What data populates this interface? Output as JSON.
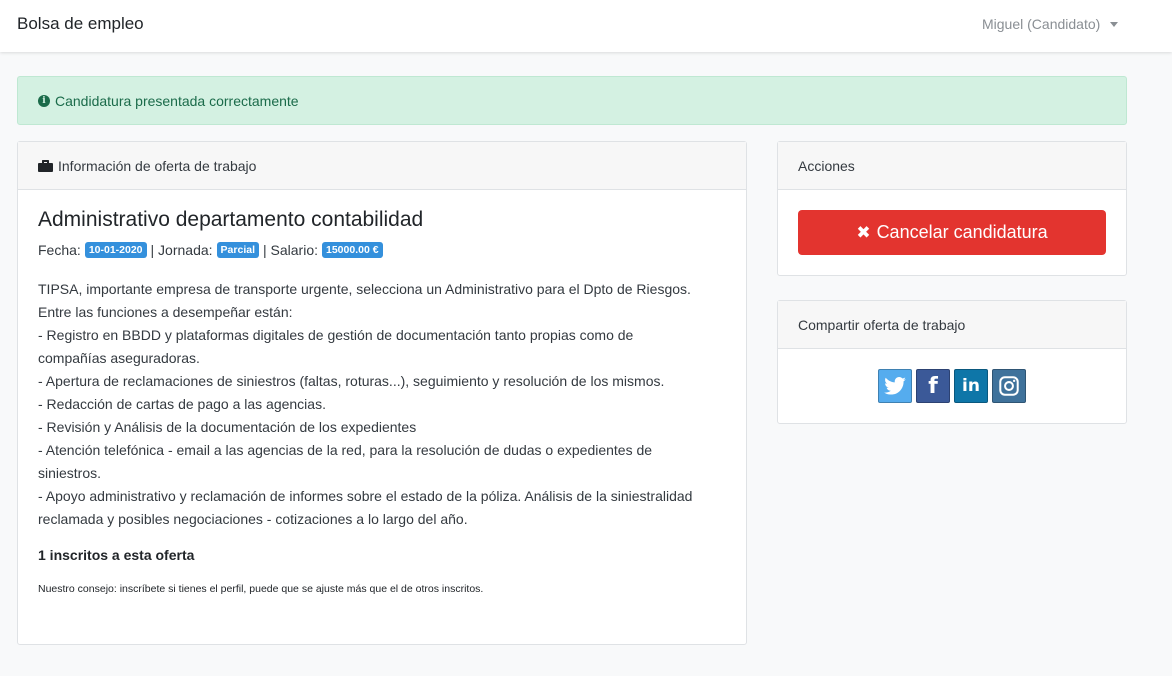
{
  "navbar": {
    "brand": "Bolsa de empleo",
    "user": "Miguel (Candidato)"
  },
  "alert": {
    "icon": "info-circle-icon",
    "message": "Candidatura presentada correctamente",
    "color": "#d4f1e2"
  },
  "job_card": {
    "header_icon": "briefcase-icon",
    "header": "Información de oferta de trabajo",
    "title": "Administrativo departamento contabilidad",
    "fecha_label": "Fecha:",
    "fecha": "10-01-2020",
    "jornada_label": "| Jornada:",
    "jornada": "Parcial",
    "salario_label": "| Salario:",
    "salario": "15000.00 €",
    "description": [
      "TIPSA, importante empresa de transporte urgente, selecciona un Administrativo para el Dpto de Riesgos.",
      "Entre las funciones a desempeñar están:",
      "- Registro en BBDD y plataformas digitales de gestión de documentación tanto propias como de",
      "compañías aseguradoras.",
      "- Apertura de reclamaciones de siniestros (faltas, roturas...), seguimiento y resolución de los mismos.",
      "- Redacción de cartas de pago a las agencias.",
      "- Revisión y Análisis de la documentación de los expedientes",
      "- Atención telefónica - email a las agencias de la red, para la resolución de dudas o expedientes de",
      "siniestros.",
      "- Apoyo administrativo y reclamación de informes sobre el estado de la póliza. Análisis de la siniestralidad",
      "reclamada y posibles negociaciones - cotizaciones a lo largo del año."
    ],
    "enrolled": "1 inscritos a esta oferta",
    "advice": "Nuestro consejo: inscríbete si tienes el perfil, puede que se ajuste más que el de otros inscritos."
  },
  "actions_card": {
    "header": "Acciones",
    "cancel_label": "Cancelar candidatura",
    "cancel_color": "#e3342f"
  },
  "share_card": {
    "header": "Compartir oferta de trabajo",
    "networks": [
      "twitter-icon",
      "facebook-icon",
      "linkedin-icon",
      "instagram-icon"
    ]
  }
}
